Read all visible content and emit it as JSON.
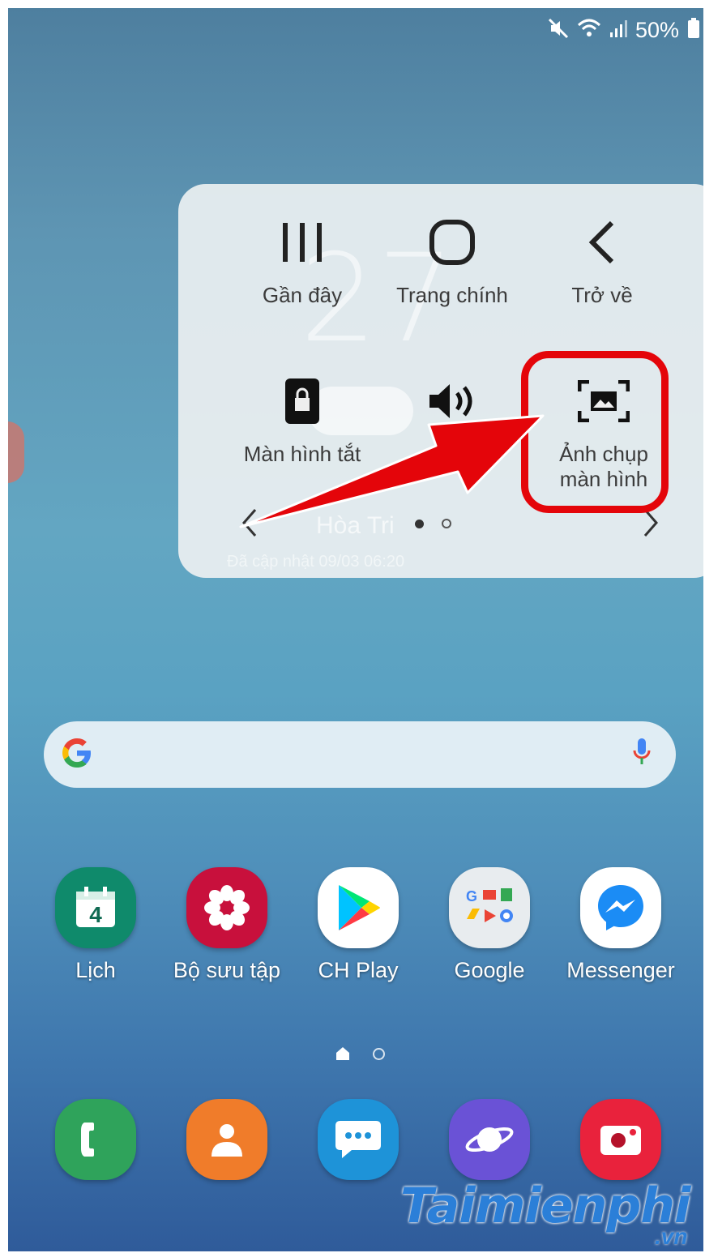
{
  "status_bar": {
    "battery": "50%"
  },
  "assistant_menu": {
    "items": [
      {
        "label": "Gần đây",
        "icon": "recents-icon"
      },
      {
        "label": "Trang chính",
        "icon": "home-icon"
      },
      {
        "label": "Trở về",
        "icon": "back-icon"
      },
      {
        "label": "Màn hình tắt",
        "icon": "lock-icon"
      },
      {
        "label": "",
        "icon": "volume-icon"
      },
      {
        "label_line1": "Ảnh chụp",
        "label_line2": "màn hình",
        "icon": "screenshot-icon"
      }
    ],
    "background_widget": {
      "clock": "27",
      "city": "Hòa Tri",
      "updated": "Đã cập nhật 09/03 06:20"
    }
  },
  "annotation": {
    "highlight_color": "#e4050a"
  },
  "search_bar": {
    "logo": "google-g-icon",
    "mic": "mic-icon"
  },
  "apps": [
    {
      "name": "Lịch",
      "icon_text": "4",
      "color": "#0f8a6b"
    },
    {
      "name": "Bộ sưu tập",
      "color": "#c8103c"
    },
    {
      "name": "CH Play",
      "color": "#ffffff"
    },
    {
      "name": "Google",
      "color": "#e8ecef"
    },
    {
      "name": "Messenger",
      "color": "#ffffff"
    }
  ],
  "dock": [
    {
      "name": "phone",
      "color": "#2fa35b"
    },
    {
      "name": "contacts",
      "color": "#f07c2a"
    },
    {
      "name": "messages",
      "color": "#1e93d8"
    },
    {
      "name": "internet",
      "color": "#6a52d6"
    },
    {
      "name": "screen-recorder",
      "color": "#e9223c"
    }
  ],
  "watermark": {
    "main": "Taimienphi",
    "suffix": ".vn"
  }
}
